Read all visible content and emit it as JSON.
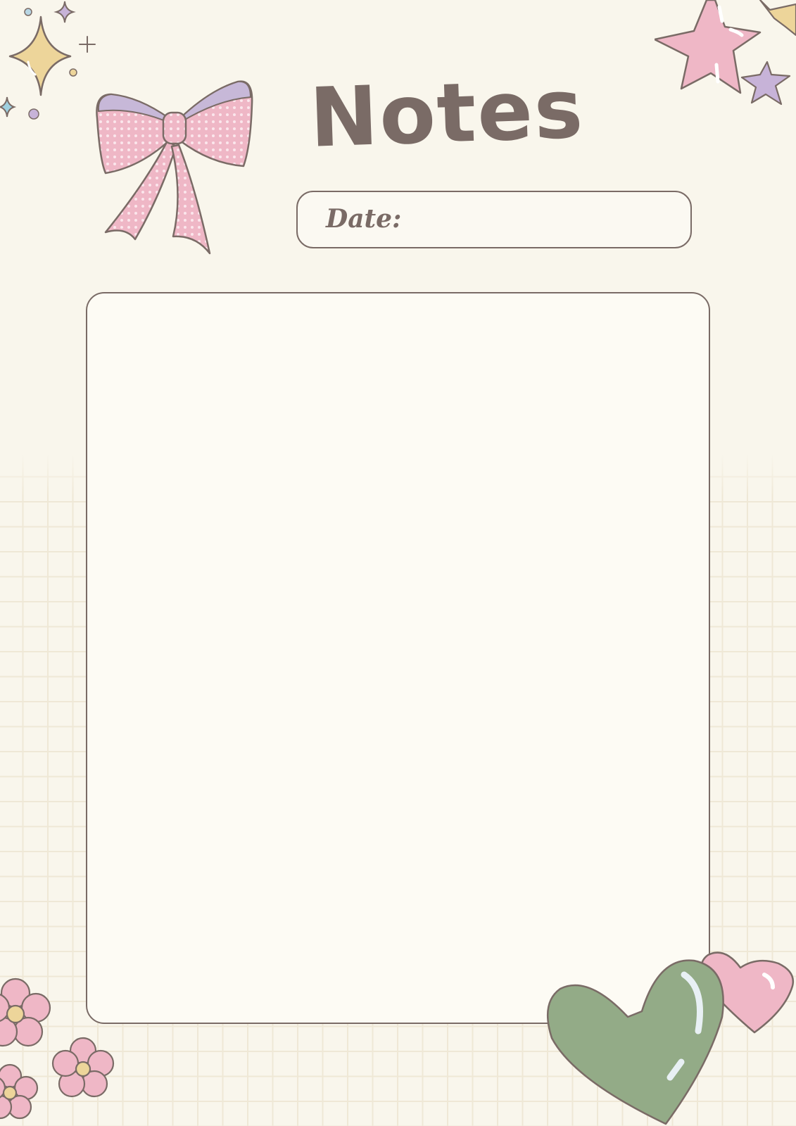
{
  "page": {
    "title": "Notes",
    "date_label": "Date:",
    "notes_area_value": ""
  },
  "colors": {
    "background": "#f9f6ec",
    "grid": "#efe8d6",
    "outline": "#7a6b66",
    "pink": "#efb7c6",
    "lavender": "#c7b3d8",
    "gold": "#edd59a",
    "green": "#93ab87"
  },
  "decorations": {
    "top_left": "sparkles-icon",
    "bow": "bow-icon",
    "top_right": "stars-icon",
    "bottom_left": "flowers-icon",
    "bottom_right": "hearts-icon"
  }
}
